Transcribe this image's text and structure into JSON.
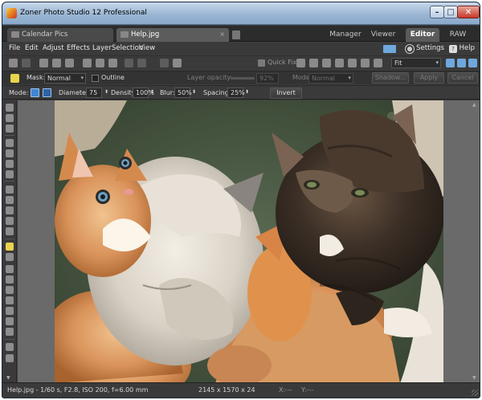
{
  "window": {
    "title": "Zoner Photo Studio 12 Professional",
    "controls": {
      "minimize": "–",
      "maximize": "□",
      "close": "✕"
    }
  },
  "tabs": [
    {
      "label": "Calendar Pics",
      "close": ""
    },
    {
      "label": "Help.jpg",
      "close": "×"
    }
  ],
  "modes": [
    "Manager",
    "Viewer",
    "Editor",
    "RAW"
  ],
  "active_mode": "Editor",
  "menu": {
    "items": [
      "File",
      "Edit",
      "Adjust",
      "Effects",
      "Layer",
      "Selection",
      "View"
    ],
    "settings": "Settings",
    "help": "Help",
    "help_glyph": "?"
  },
  "toolbar1": {
    "quick_fix": "Quick Fix",
    "zoom_value": "Fit",
    "arrow": "▾"
  },
  "mask_bar": {
    "mask_label": "Mask:",
    "mask_value": "Normal",
    "outline_label": "Outline",
    "layer_opacity_label": "Layer opacity:",
    "layer_opacity_value": "92%",
    "mode_label": "Mode:",
    "mode_value": "Normal",
    "shadow_button": "Shadow...",
    "apply_button": "Apply",
    "cancel_button": "Cancel"
  },
  "brush_bar": {
    "mode_label": "Mode:",
    "diameter_label": "Diameter:",
    "diameter_value": "75",
    "density_label": "Density:",
    "density_value": "100%",
    "blur_label": "Blur:",
    "blur_value": "50%",
    "spacing_label": "Spacing:",
    "spacing_value": "25%",
    "invert_button": "Invert",
    "spin": "⬍"
  },
  "status": {
    "info": "Help.jpg - 1/60 s, F2.8, ISO 200, f=6.00 mm",
    "dimensions": "2145 x 1570 x 24",
    "x_coord": "X:---",
    "y_coord": "Y:---"
  },
  "colors": {
    "accent": "#3f86d6",
    "active_tool": "#e8d44d",
    "chrome": "#3a3a3a"
  }
}
